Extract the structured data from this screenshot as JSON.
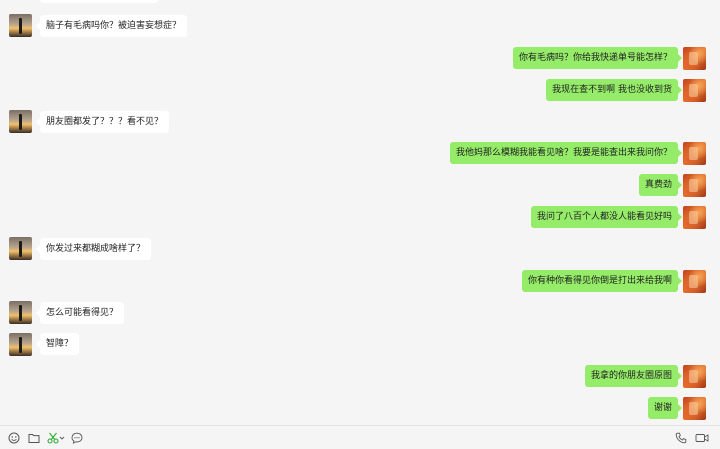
{
  "colors": {
    "background": "#f5f5f5",
    "incoming_bubble": "#ffffff",
    "outgoing_bubble": "#95ec69",
    "text": "#222222"
  },
  "messages": [
    {
      "side": "left",
      "text": "脑子有毛病吗你？被迫害妄想症？"
    },
    {
      "side": "right",
      "text": "你有毛病吗？你给我快递单号能怎样？"
    },
    {
      "side": "right",
      "text": "我现在查不到啊  我也没收到货"
    },
    {
      "side": "left",
      "text": "朋友圈都发了？？？看不见？"
    },
    {
      "side": "right",
      "text": "我他妈那么模糊我能看见啥？我要是能查出来我问你？"
    },
    {
      "side": "right",
      "text": "真费劲"
    },
    {
      "side": "right",
      "text": "我问了八百个人都没人能看见好吗"
    },
    {
      "side": "left",
      "text": "你发过来都糊成啥样了？"
    },
    {
      "side": "right",
      "text": "你有种你看得见你倒是打出来给我啊"
    },
    {
      "side": "left",
      "text": "怎么可能看得见？"
    },
    {
      "side": "left",
      "text": "智障？"
    },
    {
      "side": "right",
      "text": "我拿的你朋友圈原图"
    },
    {
      "side": "right",
      "text": "谢谢"
    }
  ],
  "toolbar": {
    "left_icons": [
      "emoji-icon",
      "folder-icon",
      "scissors-icon",
      "chat-history-icon"
    ],
    "right_icons": [
      "phone-icon",
      "video-call-icon"
    ]
  }
}
